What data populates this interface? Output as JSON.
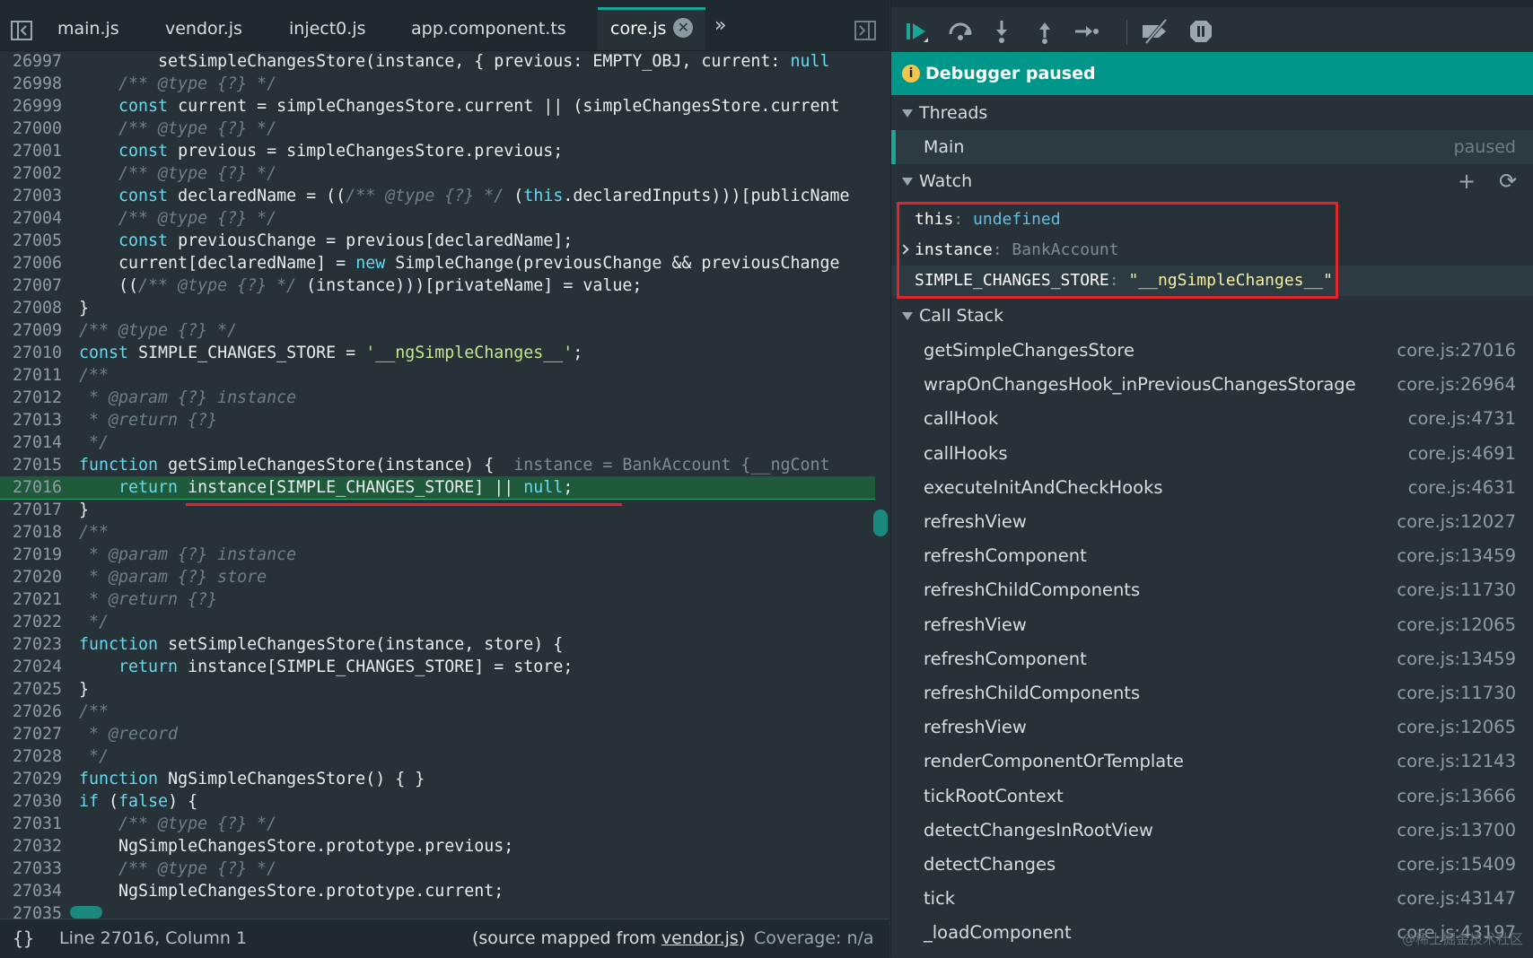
{
  "editor": {
    "tabs": [
      "main.js",
      "vendor.js",
      "inject0.js",
      "app.component.ts",
      "core.js"
    ],
    "active_tab": "core.js",
    "tab_close_glyph": "✕",
    "more_tabs_glyph": "»",
    "lines": [
      {
        "n": "26997",
        "t": "        setSimpleChangesStore(instance, { previous: EMPTY_OBJ, current: null"
      },
      {
        "n": "26998",
        "t": "    /** @type {?} */",
        "c": "comment"
      },
      {
        "n": "26999",
        "t": "    const current = simpleChangesStore.current || (simpleChangesStore.current"
      },
      {
        "n": "27000",
        "t": "    /** @type {?} */",
        "c": "comment"
      },
      {
        "n": "27001",
        "t": "    const previous = simpleChangesStore.previous;"
      },
      {
        "n": "27002",
        "t": "    /** @type {?} */",
        "c": "comment"
      },
      {
        "n": "27003",
        "t": "    const declaredName = ((/** @type {?} */ (this.declaredInputs)))[publicName"
      },
      {
        "n": "27004",
        "t": "    /** @type {?} */",
        "c": "comment"
      },
      {
        "n": "27005",
        "t": "    const previousChange = previous[declaredName];"
      },
      {
        "n": "27006",
        "t": "    current[declaredName] = new SimpleChange(previousChange && previousChange"
      },
      {
        "n": "27007",
        "t": "    ((/** @type {?} */ (instance)))[privateName] = value;"
      },
      {
        "n": "27008",
        "t": "}"
      },
      {
        "n": "27009",
        "t": "/** @type {?} */",
        "c": "comment"
      },
      {
        "n": "27010",
        "t": "const SIMPLE_CHANGES_STORE = '__ngSimpleChanges__';"
      },
      {
        "n": "27011",
        "t": "/**",
        "c": "comment"
      },
      {
        "n": "27012",
        "t": " * @param {?} instance",
        "c": "comment"
      },
      {
        "n": "27013",
        "t": " * @return {?}",
        "c": "comment"
      },
      {
        "n": "27014",
        "t": " */",
        "c": "comment"
      },
      {
        "n": "27015",
        "t": "function getSimpleChangesStore(instance) {",
        "inline": "  instance = BankAccount {__ngCont"
      },
      {
        "n": "27016",
        "t": "    return instance[SIMPLE_CHANGES_STORE] || null;",
        "exec": true
      },
      {
        "n": "27017",
        "t": "}"
      },
      {
        "n": "27018",
        "t": "/**",
        "c": "comment"
      },
      {
        "n": "27019",
        "t": " * @param {?} instance",
        "c": "comment"
      },
      {
        "n": "27020",
        "t": " * @param {?} store",
        "c": "comment"
      },
      {
        "n": "27021",
        "t": " * @return {?}",
        "c": "comment"
      },
      {
        "n": "27022",
        "t": " */",
        "c": "comment"
      },
      {
        "n": "27023",
        "t": "function setSimpleChangesStore(instance, store) {"
      },
      {
        "n": "27024",
        "t": "    return instance[SIMPLE_CHANGES_STORE] = store;"
      },
      {
        "n": "27025",
        "t": "}"
      },
      {
        "n": "27026",
        "t": "/**",
        "c": "comment"
      },
      {
        "n": "27027",
        "t": " * @record",
        "c": "comment"
      },
      {
        "n": "27028",
        "t": " */",
        "c": "comment"
      },
      {
        "n": "27029",
        "t": "function NgSimpleChangesStore() { }"
      },
      {
        "n": "27030",
        "t": "if (false) {"
      },
      {
        "n": "27031",
        "t": "    /** @type {?} */",
        "c": "comment"
      },
      {
        "n": "27032",
        "t": "    NgSimpleChangesStore.prototype.previous;"
      },
      {
        "n": "27033",
        "t": "    /** @type {?} */",
        "c": "comment"
      },
      {
        "n": "27034",
        "t": "    NgSimpleChangesStore.prototype.current;"
      },
      {
        "n": "27035",
        "t": ""
      }
    ]
  },
  "status": {
    "braces": "{}",
    "position": "Line 27016, Column 1",
    "mapped_prefix": "(source mapped from ",
    "mapped_link": "vendor.js",
    "mapped_suffix": ")",
    "coverage": "Coverage: n/a"
  },
  "debugger": {
    "banner": "Debugger paused",
    "banner_icon": "i",
    "threads_title": "Threads",
    "thread": {
      "name": "Main",
      "state": "paused"
    },
    "watch_title": "Watch",
    "watch_add": "+",
    "watch_refresh": "⟳",
    "watch": [
      {
        "key": "this",
        "value": "undefined",
        "kind": "undef"
      },
      {
        "key": "instance",
        "value": "BankAccount",
        "kind": "type",
        "expandable": true
      },
      {
        "key": "SIMPLE_CHANGES_STORE",
        "value": "\"__ngSimpleChanges__\"",
        "kind": "str",
        "selected": true
      }
    ],
    "callstack_title": "Call Stack",
    "frames": [
      {
        "fn": "getSimpleChangesStore",
        "loc": "core.js:27016"
      },
      {
        "fn": "wrapOnChangesHook_inPreviousChangesStorage",
        "loc": "core.js:26964"
      },
      {
        "fn": "callHook",
        "loc": "core.js:4731"
      },
      {
        "fn": "callHooks",
        "loc": "core.js:4691"
      },
      {
        "fn": "executeInitAndCheckHooks",
        "loc": "core.js:4631"
      },
      {
        "fn": "refreshView",
        "loc": "core.js:12027"
      },
      {
        "fn": "refreshComponent",
        "loc": "core.js:13459"
      },
      {
        "fn": "refreshChildComponents",
        "loc": "core.js:11730"
      },
      {
        "fn": "refreshView",
        "loc": "core.js:12065"
      },
      {
        "fn": "refreshComponent",
        "loc": "core.js:13459"
      },
      {
        "fn": "refreshChildComponents",
        "loc": "core.js:11730"
      },
      {
        "fn": "refreshView",
        "loc": "core.js:12065"
      },
      {
        "fn": "renderComponentOrTemplate",
        "loc": "core.js:12143"
      },
      {
        "fn": "tickRootContext",
        "loc": "core.js:13666"
      },
      {
        "fn": "detectChangesInRootView",
        "loc": "core.js:13700"
      },
      {
        "fn": "detectChanges",
        "loc": "core.js:15409"
      },
      {
        "fn": "tick",
        "loc": "core.js:43147"
      },
      {
        "fn": "_loadComponent",
        "loc": "core.js:43197"
      }
    ]
  },
  "watermark": "@稀土掘金技术社区",
  "colors": {
    "accent": "#00968a",
    "exec_line": "#1f5a3b",
    "highlight": "#e0262a"
  }
}
